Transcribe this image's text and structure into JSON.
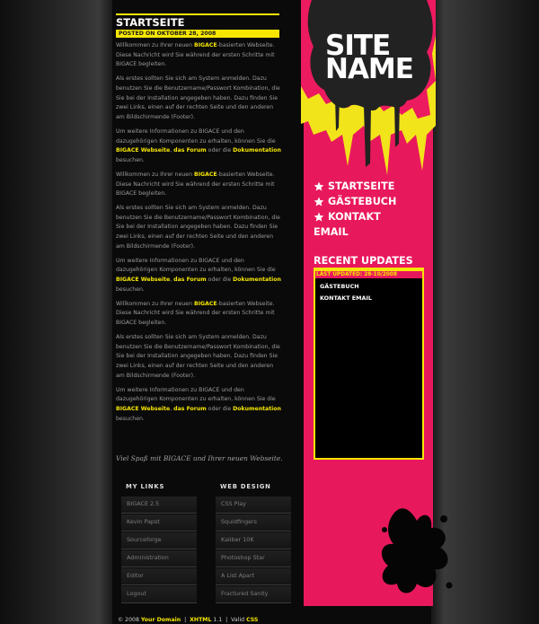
{
  "site": {
    "name_line1": "SITE",
    "name_line2": "NAME"
  },
  "page": {
    "title": "STARTSEITE",
    "posted": "POSTED ON OKTOBER 28, 2008",
    "signoff": "Viel Spaß mit BIGACE und Ihrer neuen Webseite."
  },
  "paragraphs": {
    "p1_a": "Willkommen zu Ihrer neuen ",
    "p1_hl": "BIGACE",
    "p1_b": "-basierten Webseite. Diese Nachricht wird Sie während der ersten Schritte mit BIGACE begleiten.",
    "p2": "Als erstes sollten Sie sich am System anmelden. Dazu benutzen Sie die Benutzername/Passwort Kombination, die Sie bei der Installation angegeben haben. Dazu finden Sie zwei Links, einen auf der rechten Seite und den anderen am Bildschirmende (Footer).",
    "p3_a": "Um weitere Informationen zu BIGACE und den dazugehörigen Komponenten zu erhalten, können Sie die ",
    "p3_l1": "BIGACE Webseite",
    "p3_sep": ", ",
    "p3_l2": "das Forum",
    "p3_b": " oder die ",
    "p3_l3": "Dokumentation",
    "p3_c": " besuchen."
  },
  "nav": {
    "items": [
      "STARTSEITE",
      "GÄSTEBUCH",
      "KONTAKT",
      "EMAIL"
    ]
  },
  "updates": {
    "title": "RECENT UPDATES",
    "date": "LAST UPDATED: 28-10/2008",
    "items": [
      "GÄSTEBUCH",
      "KONTAKT EMAIL"
    ]
  },
  "my_links": {
    "title": "MY LINKS",
    "items": [
      "BIGACE 2.5",
      "Kevin Papst",
      "Sourceforge",
      "Administration",
      "Editor",
      "Logout"
    ]
  },
  "web_design": {
    "title": "WEB DESIGN",
    "items": [
      "CSS Play",
      "Squidfingers",
      "Kaliber 10K",
      "Photoshop Star",
      "A List Apart",
      "Fractured Sanity"
    ]
  },
  "footer": {
    "copy": "© 2008 ",
    "domain": "Your Domain",
    "sep1": "  |  ",
    "xhtml": "XHTML",
    "xhtml_ver": " 1.1  |  Valid ",
    "css": "CSS"
  },
  "colors": {
    "accent": "#f6e600",
    "pink": "#e8185d",
    "background": "#0a0a0a"
  }
}
